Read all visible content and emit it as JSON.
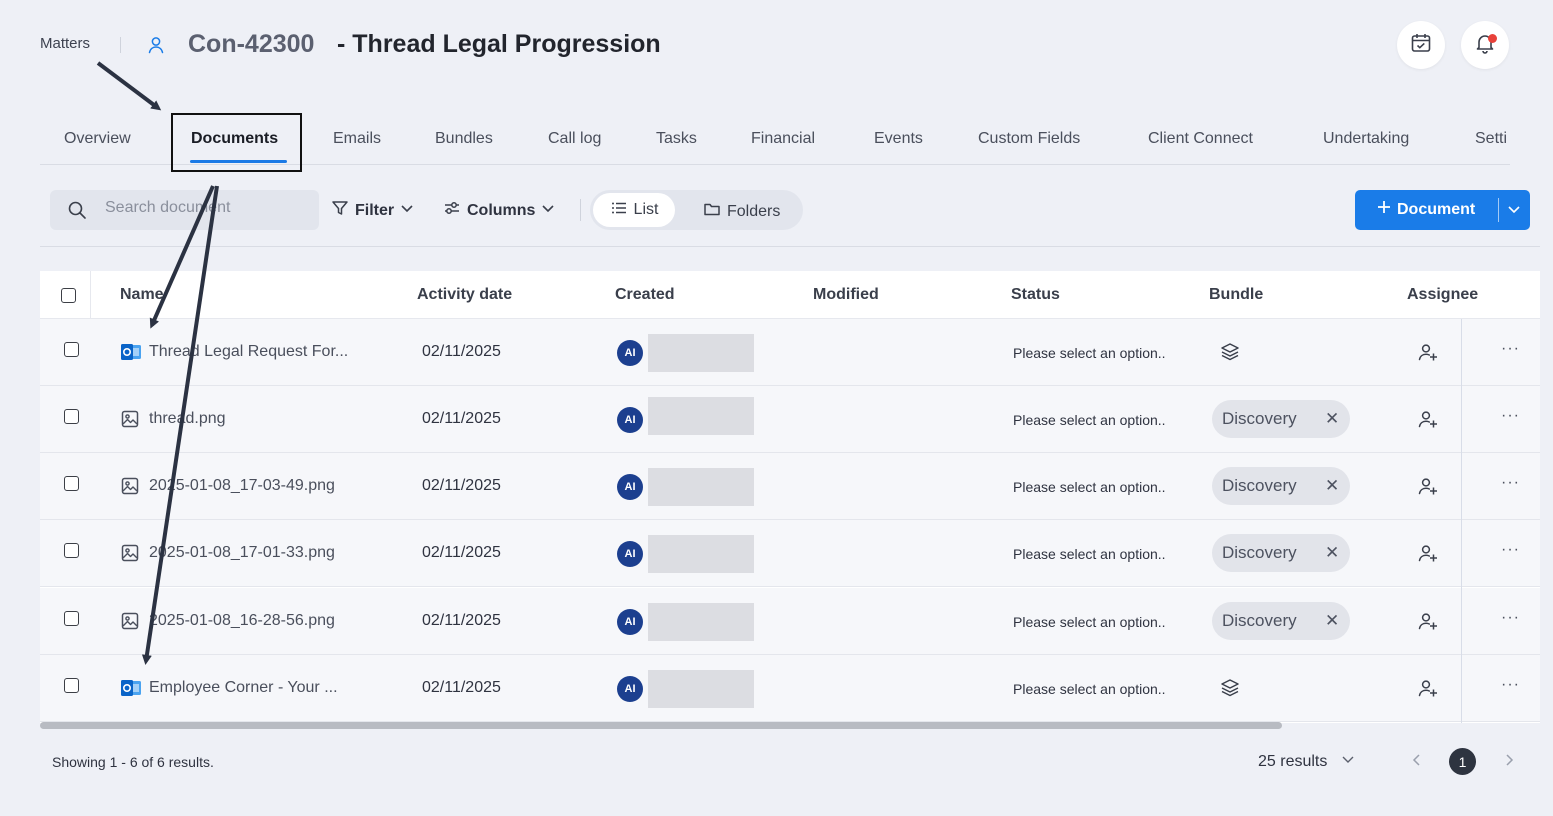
{
  "header": {
    "breadcrumb": "Matters",
    "matter_id": "Con-42300",
    "matter_title": "- Thread Legal Progression"
  },
  "tabs": [
    {
      "label": "Overview",
      "active": false
    },
    {
      "label": "Documents",
      "active": true
    },
    {
      "label": "Emails",
      "active": false
    },
    {
      "label": "Bundles",
      "active": false
    },
    {
      "label": "Call log",
      "active": false
    },
    {
      "label": "Tasks",
      "active": false
    },
    {
      "label": "Financial",
      "active": false
    },
    {
      "label": "Events",
      "active": false
    },
    {
      "label": "Custom Fields",
      "active": false
    },
    {
      "label": "Client Connect",
      "active": false
    },
    {
      "label": "Undertaking",
      "active": false
    },
    {
      "label": "Setti",
      "active": false
    }
  ],
  "toolbar": {
    "search_placeholder": "Search document",
    "filter_label": "Filter",
    "columns_label": "Columns",
    "view_list": "List",
    "view_folders": "Folders",
    "add_document": "Document"
  },
  "table": {
    "headers": {
      "name": "Name",
      "activity_date": "Activity date",
      "created": "Created",
      "modified": "Modified",
      "status": "Status",
      "bundle": "Bundle",
      "assignee": "Assignee"
    },
    "rows": [
      {
        "icon": "outlook-icon",
        "name": "Thread Legal Request For...",
        "activity_date": "02/11/2025",
        "creator_initials": "AI",
        "status": "Please select an option..",
        "bundle": ""
      },
      {
        "icon": "image-file-icon",
        "name": "thread.png",
        "activity_date": "02/11/2025",
        "creator_initials": "AI",
        "status": "Please select an option..",
        "bundle": "Discovery"
      },
      {
        "icon": "image-file-icon",
        "name": "2025-01-08_17-03-49.png",
        "activity_date": "02/11/2025",
        "creator_initials": "AI",
        "status": "Please select an option..",
        "bundle": "Discovery"
      },
      {
        "icon": "image-file-icon",
        "name": "2025-01-08_17-01-33.png",
        "activity_date": "02/11/2025",
        "creator_initials": "AI",
        "status": "Please select an option..",
        "bundle": "Discovery"
      },
      {
        "icon": "image-file-icon",
        "name": "2025-01-08_16-28-56.png",
        "activity_date": "02/11/2025",
        "creator_initials": "AI",
        "status": "Please select an option..",
        "bundle": "Discovery"
      },
      {
        "icon": "outlook-icon",
        "name": "Employee Corner - Your ...",
        "activity_date": "02/11/2025",
        "creator_initials": "AI",
        "status": "Please select an option..",
        "bundle": ""
      }
    ]
  },
  "footer": {
    "showing": "Showing 1 - 6 of 6 results.",
    "per_page": "25 results",
    "current_page": "1"
  },
  "colors": {
    "accent": "#1a7ce8",
    "background": "#eef0f6",
    "avatar": "#1c3f8f",
    "notification_dot": "#e8413a"
  }
}
